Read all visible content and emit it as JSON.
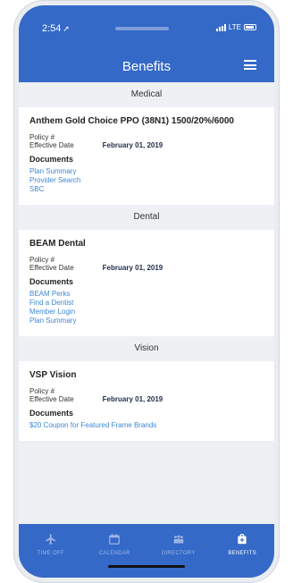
{
  "status": {
    "time": "2:54",
    "network": "LTE"
  },
  "header": {
    "title": "Benefits"
  },
  "sections": [
    {
      "name": "Medical",
      "plan": "Anthem Gold Choice PPO (38N1) 1500/20%/6000",
      "policy_label": "Policy #",
      "effective_label": "Effective Date",
      "effective_date": "February 01, 2019",
      "documents_label": "Documents",
      "documents": [
        "Plan Summary",
        "Provider Search",
        "SBC"
      ]
    },
    {
      "name": "Dental",
      "plan": "BEAM Dental",
      "policy_label": "Policy #",
      "effective_label": "Effective Date",
      "effective_date": "February 01, 2019",
      "documents_label": "Documents",
      "documents": [
        "BEAM Perks",
        "Find a Dentist",
        "Member Login",
        "Plan Summary"
      ]
    },
    {
      "name": "Vision",
      "plan": "VSP Vision",
      "policy_label": "Policy #",
      "effective_label": "Effective Date",
      "effective_date": "February 01, 2019",
      "documents_label": "Documents",
      "documents": [
        "$20 Coupon for Featured Frame Brands"
      ]
    }
  ],
  "tabs": [
    {
      "label": "TIME OFF",
      "icon": "plane-icon",
      "active": false
    },
    {
      "label": "CALENDAR",
      "icon": "calendar-icon",
      "active": false
    },
    {
      "label": "DIRECTORY",
      "icon": "people-icon",
      "active": false
    },
    {
      "label": "BENEFITS",
      "icon": "benefits-icon",
      "active": true
    }
  ],
  "colors": {
    "brand": "#3469c8",
    "link": "#3d88d6",
    "background": "#eef0f3"
  }
}
